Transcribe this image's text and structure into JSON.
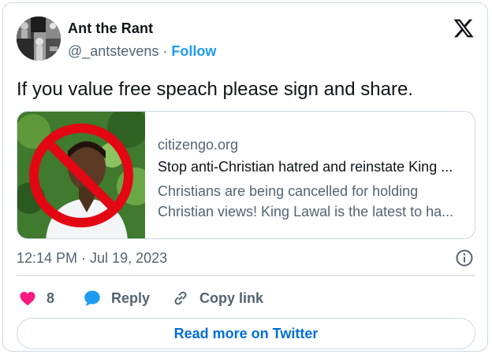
{
  "author": {
    "name": "Ant the Rant",
    "handle": "@_antstevens",
    "separator": "·",
    "follow_label": "Follow"
  },
  "tweet": {
    "text": "If you value free speach please sign and share."
  },
  "link_card": {
    "domain": "citizengo.org",
    "title": "Stop anti-Christian hatred and reinstate King ...",
    "description_line1": "Christians are being cancelled for holding",
    "description_line2": "Christian views! King Lawal is the latest to ha..."
  },
  "meta": {
    "timestamp": "12:14 PM · Jul 19, 2023"
  },
  "actions": {
    "like_count": "8",
    "reply_label": "Reply",
    "copy_label": "Copy link"
  },
  "cta": {
    "read_more_label": "Read more on Twitter"
  },
  "colors": {
    "like": "#f91880",
    "reply": "#1d9bf0",
    "link": "#1d9bf0",
    "cta": "#006fd6",
    "secondary_text": "#536471",
    "border": "#cfd9de"
  },
  "icons": {
    "brand": "x-logo-icon",
    "info": "info-icon",
    "like": "heart-icon",
    "reply": "speech-bubble-icon",
    "copy": "link-chain-icon"
  }
}
